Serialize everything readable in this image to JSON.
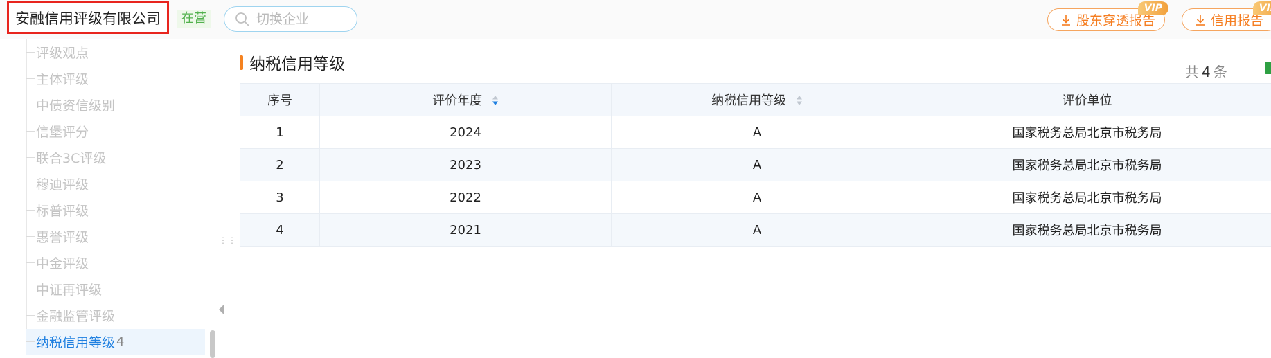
{
  "header": {
    "company_name": "安融信用评级有限公司",
    "status_tag": "在营",
    "search_placeholder": "切换企业",
    "buttons": [
      {
        "label": "股东穿透报告",
        "badge": "VIP"
      },
      {
        "label": "信用报告",
        "badge": "VIP"
      }
    ]
  },
  "sidebar": {
    "items": [
      {
        "label": "评级观点",
        "active": false
      },
      {
        "label": "主体评级",
        "active": false
      },
      {
        "label": "中债资信级别",
        "active": false
      },
      {
        "label": "信堡评分",
        "active": false
      },
      {
        "label": "联合3C评级",
        "active": false
      },
      {
        "label": "穆迪评级",
        "active": false
      },
      {
        "label": "标普评级",
        "active": false
      },
      {
        "label": "惠誉评级",
        "active": false
      },
      {
        "label": "中金评级",
        "active": false
      },
      {
        "label": "中证再评级",
        "active": false
      },
      {
        "label": "金融监管评级",
        "active": false
      },
      {
        "label": "纳税信用等级",
        "active": true,
        "count": "4"
      }
    ]
  },
  "main": {
    "section_title": "纳税信用等级",
    "total_prefix": "共",
    "total_count": "4",
    "total_suffix": "条",
    "table": {
      "columns": [
        "序号",
        "评价年度",
        "纳税信用等级",
        "评价单位"
      ],
      "rows": [
        [
          "1",
          "2024",
          "A",
          "国家税务总局北京市税务局"
        ],
        [
          "2",
          "2023",
          "A",
          "国家税务总局北京市税务局"
        ],
        [
          "3",
          "2022",
          "A",
          "国家税务总局北京市税务局"
        ],
        [
          "4",
          "2021",
          "A",
          "国家税务总局北京市税务局"
        ]
      ]
    }
  },
  "colors": {
    "accent_orange": "#f58220",
    "active_blue": "#1e7fe0",
    "status_green": "#52b14d",
    "highlight_red": "#e8251e"
  },
  "icons": {
    "search": "search-icon",
    "download": "download-icon",
    "sort": "sort-icon",
    "export": "excel-icon"
  }
}
